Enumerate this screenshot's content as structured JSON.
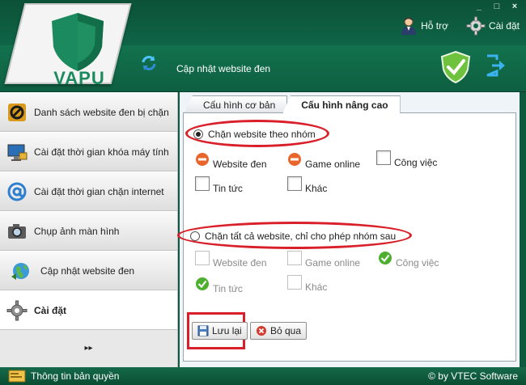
{
  "app": {
    "logo_text": "VAPU",
    "window_buttons": [
      "_",
      "□",
      "×"
    ]
  },
  "header": {
    "support_label": "Hỗ trợ",
    "settings_label": "Cài đặt",
    "update_title": "Cập nhật website đen"
  },
  "sidebar": {
    "items": [
      {
        "label": "Danh sách website đen bị chặn",
        "icon": "blocked-list-icon"
      },
      {
        "label": "Cài đặt thời gian khóa máy tính",
        "icon": "computer-lock-icon"
      },
      {
        "label": "Cài đặt thời gian chặn internet",
        "icon": "at-sign-icon"
      },
      {
        "label": "Chụp ảnh màn hình",
        "icon": "camera-icon"
      },
      {
        "label": "Cập nhật website đen",
        "icon": "globe-update-icon"
      },
      {
        "label": "Cài đặt",
        "icon": "gear-icon"
      }
    ],
    "more_label": "▸▸"
  },
  "tabs": [
    {
      "label": "Cấu hình cơ bản",
      "active": false
    },
    {
      "label": "Cấu hình nâng cao",
      "active": true
    }
  ],
  "group_mode": {
    "label": "Chặn website theo nhóm",
    "selected": true,
    "options": [
      {
        "label": "Website đen",
        "state": "blocked"
      },
      {
        "label": "Game online",
        "state": "blocked"
      },
      {
        "label": "Công việc",
        "state": "unchecked"
      },
      {
        "label": "Tin tức",
        "state": "unchecked"
      },
      {
        "label": "Khác",
        "state": "unchecked"
      }
    ]
  },
  "allow_mode": {
    "label": "Chặn tất cả website, chỉ cho phép nhóm sau",
    "selected": false,
    "options": [
      {
        "label": "Website đen",
        "state": "unchecked"
      },
      {
        "label": "Game online",
        "state": "unchecked"
      },
      {
        "label": "Công việc",
        "state": "allowed"
      },
      {
        "label": "Tin tức",
        "state": "allowed"
      },
      {
        "label": "Khác",
        "state": "unchecked"
      }
    ]
  },
  "buttons": {
    "save": "Lưu lại",
    "cancel": "Bỏ qua"
  },
  "status": {
    "license": "Thông tin bản quyền",
    "copyright": "© by VTEC Software"
  },
  "colors": {
    "brand_green": "#0f6447",
    "highlight_red": "#d9202a"
  }
}
